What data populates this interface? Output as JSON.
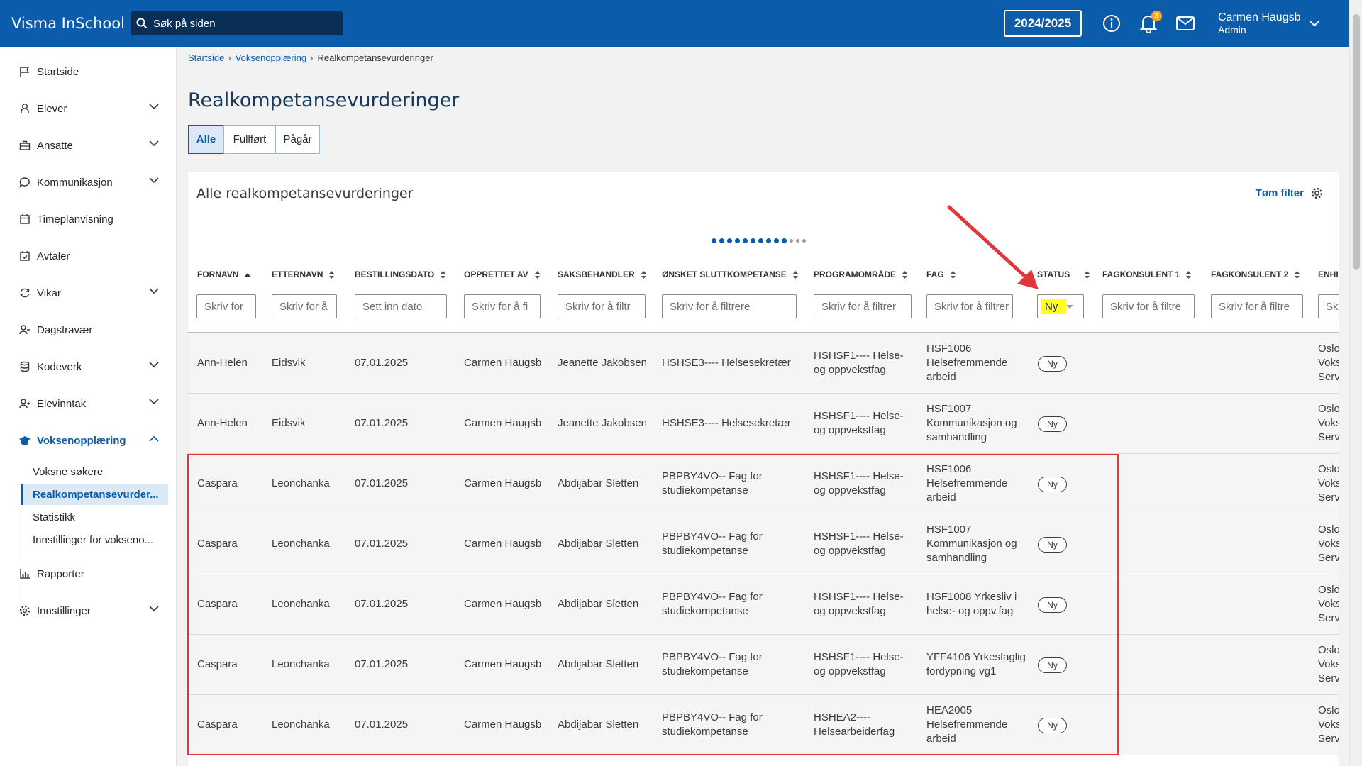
{
  "app": {
    "title": "Visma InSchool",
    "search_placeholder": "Søk på siden",
    "year": "2024/2025",
    "notification_count": "3",
    "user_name": "Carmen Haugsb",
    "user_role": "Admin"
  },
  "sidebar": {
    "items": [
      {
        "label": "Startside",
        "icon": "flag-icon"
      },
      {
        "label": "Elever",
        "icon": "student-icon"
      },
      {
        "label": "Ansatte",
        "icon": "briefcase-icon"
      },
      {
        "label": "Kommunikasjon",
        "icon": "chat-icon"
      },
      {
        "label": "Timeplanvisning",
        "icon": "calendar-icon"
      },
      {
        "label": "Avtaler",
        "icon": "calendar-check-icon"
      },
      {
        "label": "Vikar",
        "icon": "refresh-icon"
      },
      {
        "label": "Dagsfravær",
        "icon": "user-minus-icon"
      },
      {
        "label": "Kodeverk",
        "icon": "database-icon"
      },
      {
        "label": "Elevinntak",
        "icon": "user-add-icon"
      },
      {
        "label": "Voksenopplæring",
        "icon": "graduation-cap-icon"
      },
      {
        "label": "Rapporter",
        "icon": "chart-icon"
      },
      {
        "label": "Innstillinger",
        "icon": "gear-icon"
      }
    ],
    "subitems": [
      "Voksne søkere",
      "Realkompetansevurder...",
      "Statistikk",
      "Innstillinger for vokseno..."
    ]
  },
  "breadcrumb": {
    "items": [
      "Startside",
      "Voksenopplæring"
    ],
    "current": "Realkompetansevurderinger"
  },
  "page": {
    "title": "Realkompetansevurderinger",
    "tabs": [
      "Alle",
      "Fullført",
      "Pågår"
    ],
    "active_tab": "Alle"
  },
  "table": {
    "title": "Alle realkompetansevurderinger",
    "clear_filter": "Tøm filter",
    "columns": [
      {
        "header": "FORNAVN",
        "filter": "Skriv for",
        "sort": "asc"
      },
      {
        "header": "ETTERNAVN",
        "filter": "Skriv for å"
      },
      {
        "header": "BESTILLINGSDATO",
        "filter": "Sett inn dato"
      },
      {
        "header": "OPPRETTET AV",
        "filter": "Skriv for å fi"
      },
      {
        "header": "SAKSBEHANDLER",
        "filter": "Skriv for å filtr"
      },
      {
        "header": "ØNSKET SLUTTKOMPETANSE",
        "filter": "Skriv for å filtrere"
      },
      {
        "header": "PROGRAMOMRÅDE",
        "filter": "Skriv for å filtrer"
      },
      {
        "header": "FAG",
        "filter": "Skriv for å filtrer"
      },
      {
        "header": "STATUS",
        "filter": "Ny"
      },
      {
        "header": "FAGKONSULENT 1",
        "filter": "Skriv for å filtre"
      },
      {
        "header": "FAGKONSULENT 2",
        "filter": "Skriv for å filtre"
      },
      {
        "header": "ENHI",
        "filter": "Sk"
      }
    ],
    "rows": [
      {
        "fornavn": "Ann-Helen",
        "etternavn": "Eidsvik",
        "dato": "07.01.2025",
        "opprettet": "Carmen Haugsb",
        "saksbehandler": "Jeanette Jakobsen",
        "sluttkompetanse": [
          "HSHSE3---- Helsesekretær"
        ],
        "program": [
          "HSHSF1---- Helse-",
          "og oppvekstfag"
        ],
        "fag": [
          "HSF1006",
          "Helsefremmende",
          "arbeid"
        ],
        "status": "Ny",
        "enhet": [
          "Oslo",
          "Voks",
          "Serv"
        ]
      },
      {
        "fornavn": "Ann-Helen",
        "etternavn": "Eidsvik",
        "dato": "07.01.2025",
        "opprettet": "Carmen Haugsb",
        "saksbehandler": "Jeanette Jakobsen",
        "sluttkompetanse": [
          "HSHSE3---- Helsesekretær"
        ],
        "program": [
          "HSHSF1---- Helse-",
          "og oppvekstfag"
        ],
        "fag": [
          "HSF1007",
          "Kommunikasjon og",
          "samhandling"
        ],
        "status": "Ny",
        "enhet": [
          "Oslo",
          "Voks",
          "Serv"
        ]
      },
      {
        "fornavn": "Caspara",
        "etternavn": "Leonchanka",
        "dato": "07.01.2025",
        "opprettet": "Carmen Haugsb",
        "saksbehandler": "Abdijabar Sletten",
        "sluttkompetanse": [
          "PBPBY4VO-- Fag for",
          "studiekompetanse"
        ],
        "program": [
          "HSHSF1---- Helse-",
          "og oppvekstfag"
        ],
        "fag": [
          "HSF1006",
          "Helsefremmende",
          "arbeid"
        ],
        "status": "Ny",
        "enhet": [
          "Oslo",
          "Voks",
          "Serv"
        ]
      },
      {
        "fornavn": "Caspara",
        "etternavn": "Leonchanka",
        "dato": "07.01.2025",
        "opprettet": "Carmen Haugsb",
        "saksbehandler": "Abdijabar Sletten",
        "sluttkompetanse": [
          "PBPBY4VO-- Fag for",
          "studiekompetanse"
        ],
        "program": [
          "HSHSF1---- Helse-",
          "og oppvekstfag"
        ],
        "fag": [
          "HSF1007",
          "Kommunikasjon og",
          "samhandling"
        ],
        "status": "Ny",
        "enhet": [
          "Oslo",
          "Voks",
          "Serv"
        ]
      },
      {
        "fornavn": "Caspara",
        "etternavn": "Leonchanka",
        "dato": "07.01.2025",
        "opprettet": "Carmen Haugsb",
        "saksbehandler": "Abdijabar Sletten",
        "sluttkompetanse": [
          "PBPBY4VO-- Fag for",
          "studiekompetanse"
        ],
        "program": [
          "HSHSF1---- Helse-",
          "og oppvekstfag"
        ],
        "fag": [
          "HSF1008 Yrkesliv i",
          "helse- og oppv.fag"
        ],
        "status": "Ny",
        "enhet": [
          "Oslo",
          "Voks",
          "Serv"
        ]
      },
      {
        "fornavn": "Caspara",
        "etternavn": "Leonchanka",
        "dato": "07.01.2025",
        "opprettet": "Carmen Haugsb",
        "saksbehandler": "Abdijabar Sletten",
        "sluttkompetanse": [
          "PBPBY4VO-- Fag for",
          "studiekompetanse"
        ],
        "program": [
          "HSHSF1---- Helse-",
          "og oppvekstfag"
        ],
        "fag": [
          "YFF4106 Yrkesfaglig",
          "fordypning vg1"
        ],
        "status": "Ny",
        "enhet": [
          "Oslo",
          "Voks",
          "Serv"
        ]
      },
      {
        "fornavn": "Caspara",
        "etternavn": "Leonchanka",
        "dato": "07.01.2025",
        "opprettet": "Carmen Haugsb",
        "saksbehandler": "Abdijabar Sletten",
        "sluttkompetanse": [
          "PBPBY4VO-- Fag for",
          "studiekompetanse"
        ],
        "program": [
          "HSHEA2----",
          "Helsearbeiderfag"
        ],
        "fag": [
          "HEA2005",
          "Helsefremmende",
          "arbeid"
        ],
        "status": "Ny",
        "enhet": [
          "Oslo",
          "Voks",
          "Serv"
        ]
      }
    ]
  },
  "colors": {
    "topbar": "#0b5cab",
    "accent": "#0b5cab",
    "annotation": "#e0383a",
    "highlight": "#ffff2a"
  }
}
